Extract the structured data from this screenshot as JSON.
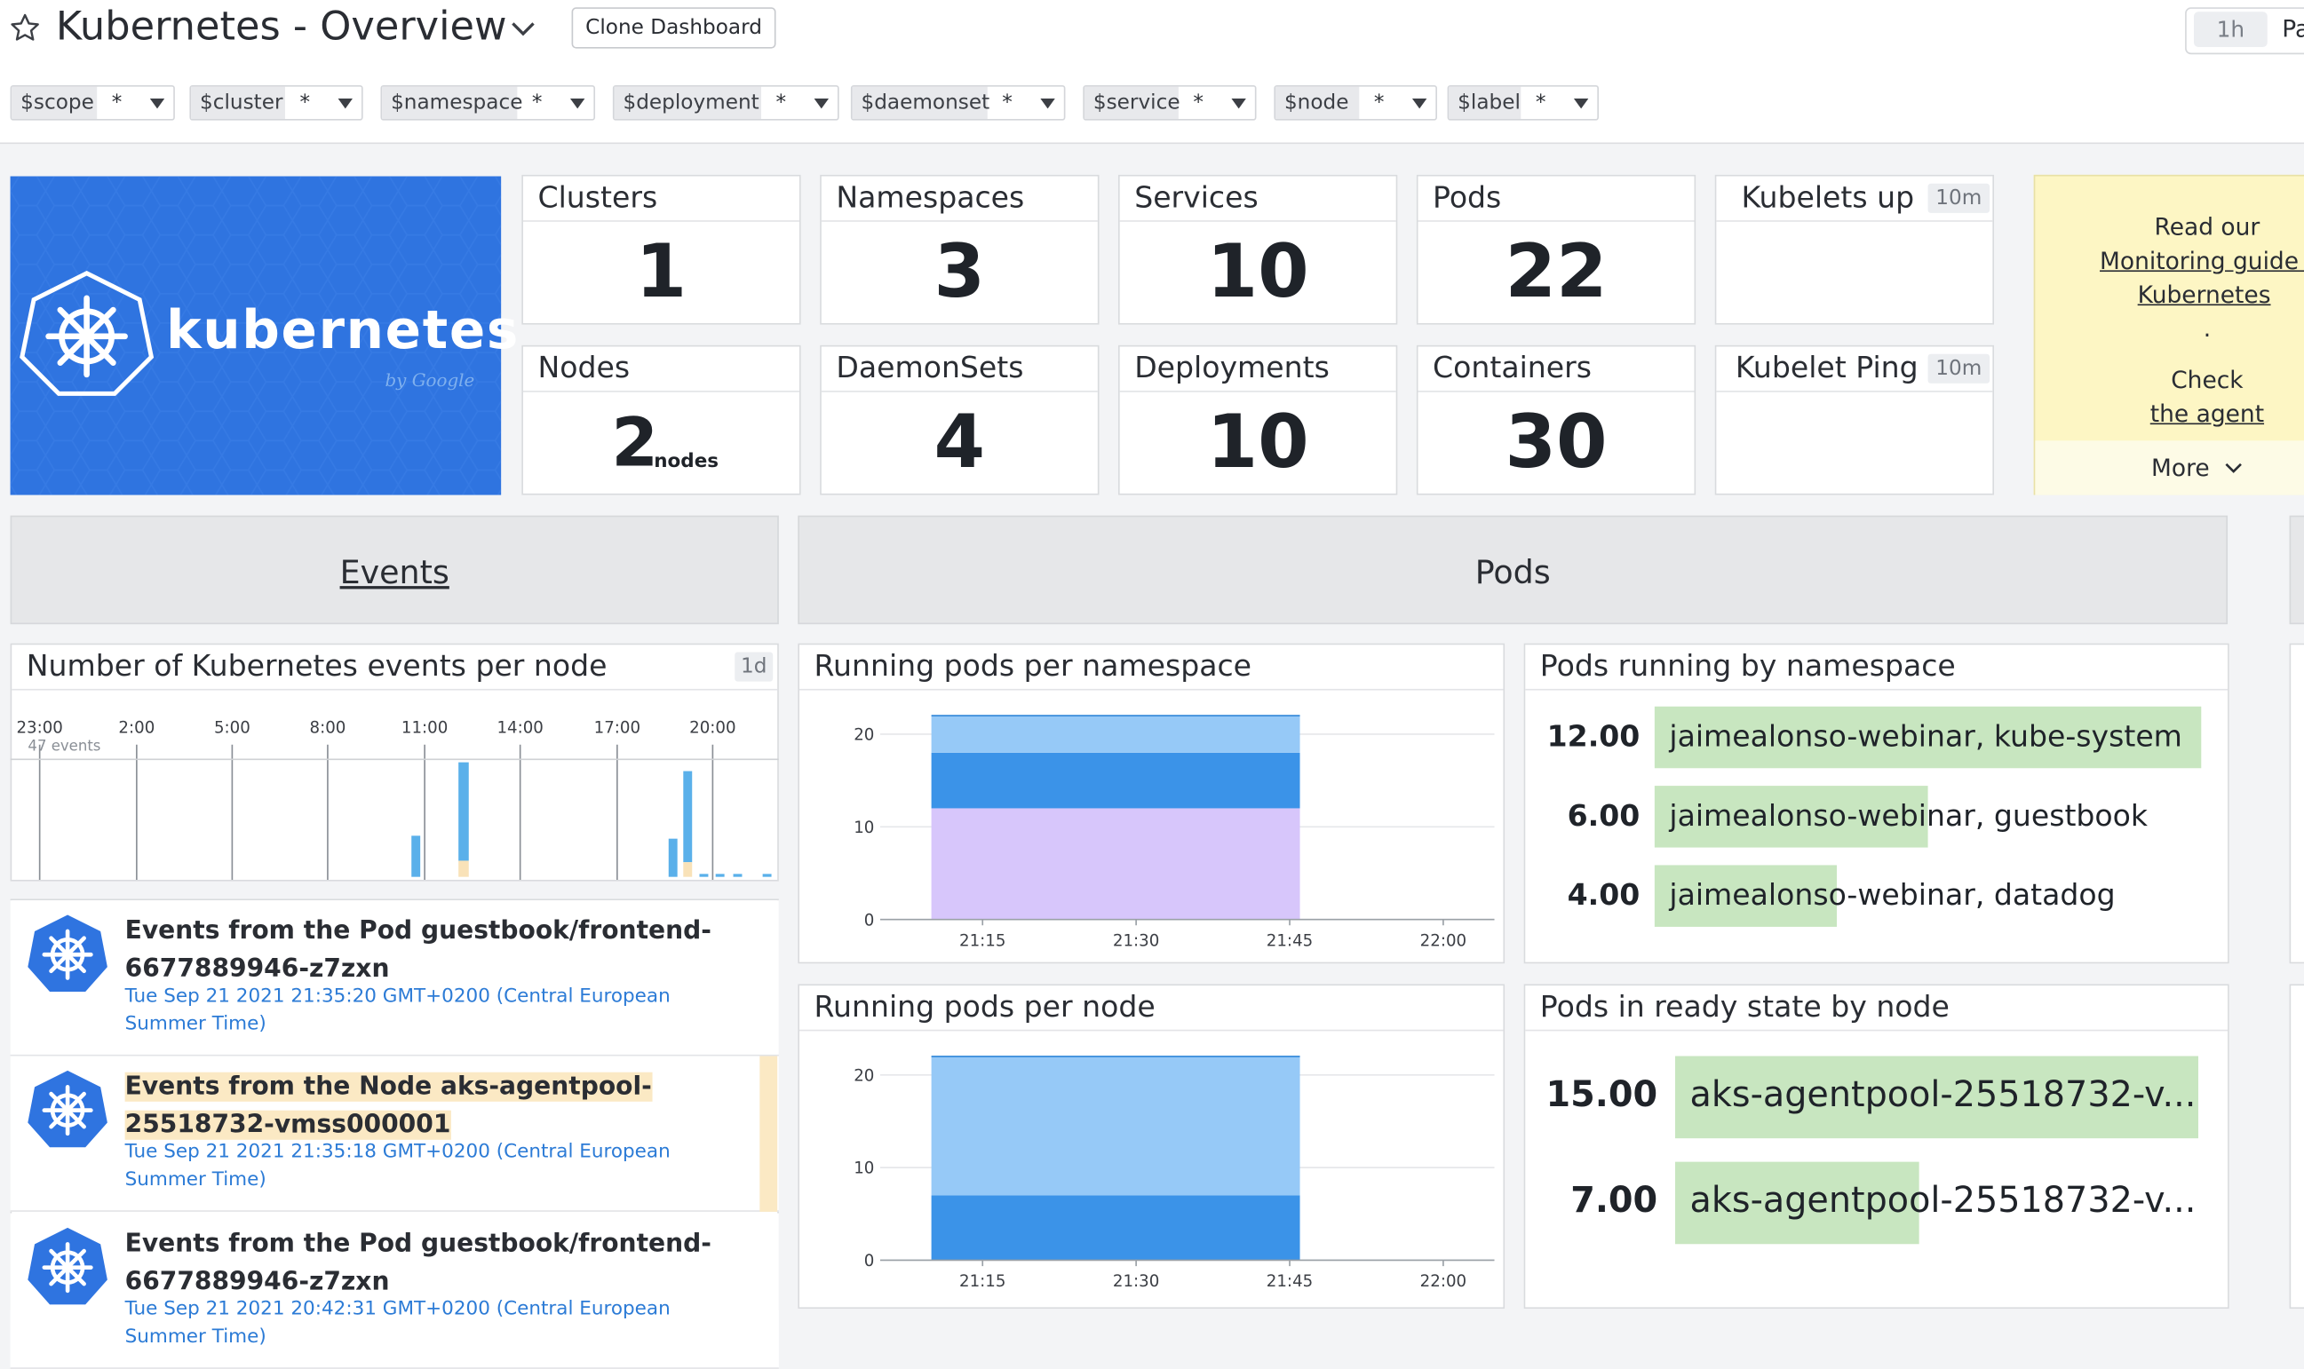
{
  "header": {
    "title": "Kubernetes - Overview",
    "clone_label": "Clone Dashboard",
    "time_range": "1h",
    "pause_partial": "Pa"
  },
  "template_vars": [
    {
      "name": "$scope",
      "value": "*"
    },
    {
      "name": "$cluster",
      "value": "*"
    },
    {
      "name": "$namespace",
      "value": "*"
    },
    {
      "name": "$deployment",
      "value": "*"
    },
    {
      "name": "$daemonset",
      "value": "*"
    },
    {
      "name": "$service",
      "value": "*"
    },
    {
      "name": "$node",
      "value": "*"
    },
    {
      "name": "$label",
      "value": "*"
    }
  ],
  "logo": {
    "word": "kubernetes",
    "by": "by Google"
  },
  "stats": {
    "clusters": {
      "title": "Clusters",
      "value": "1"
    },
    "namespaces": {
      "title": "Namespaces",
      "value": "3"
    },
    "services": {
      "title": "Services",
      "value": "10"
    },
    "pods": {
      "title": "Pods",
      "value": "22"
    },
    "kubelets": {
      "title": "Kubelets up",
      "badge": "10m"
    },
    "nodes": {
      "title": "Nodes",
      "value": "2",
      "unit": "nodes"
    },
    "daemonsets": {
      "title": "DaemonSets",
      "value": "4"
    },
    "deployments": {
      "title": "Deployments",
      "value": "10"
    },
    "containers": {
      "title": "Containers",
      "value": "30"
    },
    "kubelet_ping": {
      "title": "Kubelet Ping",
      "badge": "10m"
    }
  },
  "note": {
    "line1": "Read our",
    "link1a": "Monitoring guide f",
    "link1b": "Kubernetes",
    "dot": ".",
    "line2": "Check",
    "link2": "the agent",
    "more": "More"
  },
  "sections": {
    "events": "Events",
    "pods": "Pods"
  },
  "events_chart": {
    "title": "Number of Kubernetes events per node",
    "badge": "1d",
    "x_ticks": [
      "23:00",
      "2:00",
      "5:00",
      "8:00",
      "11:00",
      "14:00",
      "17:00",
      "20:00"
    ],
    "marker": "47 events"
  },
  "events": [
    {
      "title": "Events from the Pod guestbook/frontend-6677889946-z7zxn",
      "time": "Tue Sep 21 2021 21:35:20 GMT+0200 (Central European Summer Time)"
    },
    {
      "title": "Events from the Node aks-agentpool-25518732-vmss000001",
      "time": "Tue Sep 21 2021 21:35:18 GMT+0200 (Central European Summer Time)"
    },
    {
      "title": "Events from the Pod guestbook/frontend-6677889946-z7zxn",
      "time": "Tue Sep 21 2021 20:42:31 GMT+0200 (Central European Summer Time)"
    }
  ],
  "running_ns": {
    "title": "Running pods per namespace"
  },
  "running_node": {
    "title": "Running pods per node"
  },
  "pods_by_ns": {
    "title": "Pods running by namespace",
    "rows": [
      {
        "value": "12.00",
        "label": "jaimealonso-webinar, kube-system",
        "fraction": 1.0
      },
      {
        "value": "6.00",
        "label": "jaimealonso-webinar, guestbook",
        "fraction": 0.5
      },
      {
        "value": "4.00",
        "label": "jaimealonso-webinar, datadog",
        "fraction": 0.333
      }
    ]
  },
  "pods_ready": {
    "title": "Pods in ready state by node",
    "rows": [
      {
        "value": "15.00",
        "label": "aks-agentpool-25518732-v...",
        "fraction": 1.0
      },
      {
        "value": "7.00",
        "label": "aks-agentpool-25518732-v...",
        "fraction": 0.467
      }
    ]
  },
  "chart_data": [
    {
      "type": "area",
      "title": "Running pods per namespace",
      "x": [
        "21:15",
        "21:30",
        "21:45",
        "22:00"
      ],
      "ylim": [
        0,
        25
      ],
      "y_ticks": [
        0,
        10,
        20
      ],
      "time_span": [
        "21:10",
        "21:46"
      ],
      "series": [
        {
          "values": [
            12,
            12,
            12
          ],
          "color": "#d7c6fb"
        },
        {
          "values": [
            6,
            6,
            6
          ],
          "color": "#3b93e8"
        },
        {
          "values": [
            4,
            4,
            4
          ],
          "color": "#96c9f7"
        }
      ]
    },
    {
      "type": "area",
      "title": "Running pods per node",
      "x": [
        "21:15",
        "21:30",
        "21:45",
        "22:00"
      ],
      "ylim": [
        0,
        25
      ],
      "y_ticks": [
        0,
        10,
        20
      ],
      "time_span": [
        "21:10",
        "21:46"
      ],
      "series": [
        {
          "values": [
            7,
            7,
            7
          ],
          "color": "#3b93e8"
        },
        {
          "values": [
            15,
            15,
            15
          ],
          "color": "#96c9f7"
        }
      ]
    }
  ]
}
